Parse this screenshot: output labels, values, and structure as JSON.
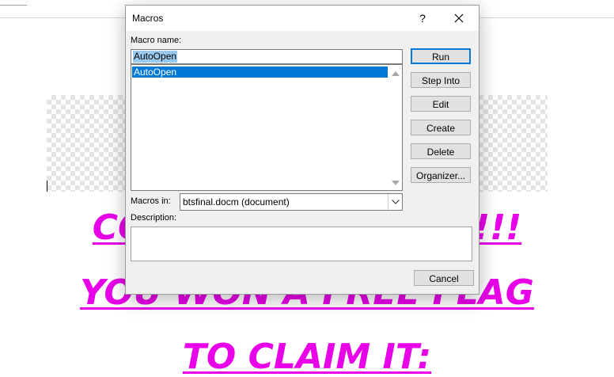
{
  "document": {
    "text_color": "#e800e8",
    "lines": [
      "CONGRATULATIONS!!!",
      "YOU WON A FREE FLAG",
      "TO CLAIM IT:"
    ]
  },
  "dialog": {
    "title": "Macros",
    "help_label": "?",
    "close_icon": "close-icon",
    "macro_name_label": "Macro name:",
    "macro_name_value": "AutoOpen",
    "macro_list": [
      "AutoOpen"
    ],
    "selected_macro_index": 0,
    "macros_in_label": "Macros in:",
    "macros_in_value": "btsfinal.docm (document)",
    "description_label": "Description:",
    "description_value": "",
    "buttons": {
      "run": "Run",
      "step_into": "Step Into",
      "edit": "Edit",
      "create": "Create",
      "delete": "Delete",
      "organizer": "Organizer...",
      "cancel": "Cancel"
    },
    "colors": {
      "selection": "#0078d7",
      "input_highlight": "#99c9ef",
      "default_button_border": "#0078d7"
    }
  }
}
